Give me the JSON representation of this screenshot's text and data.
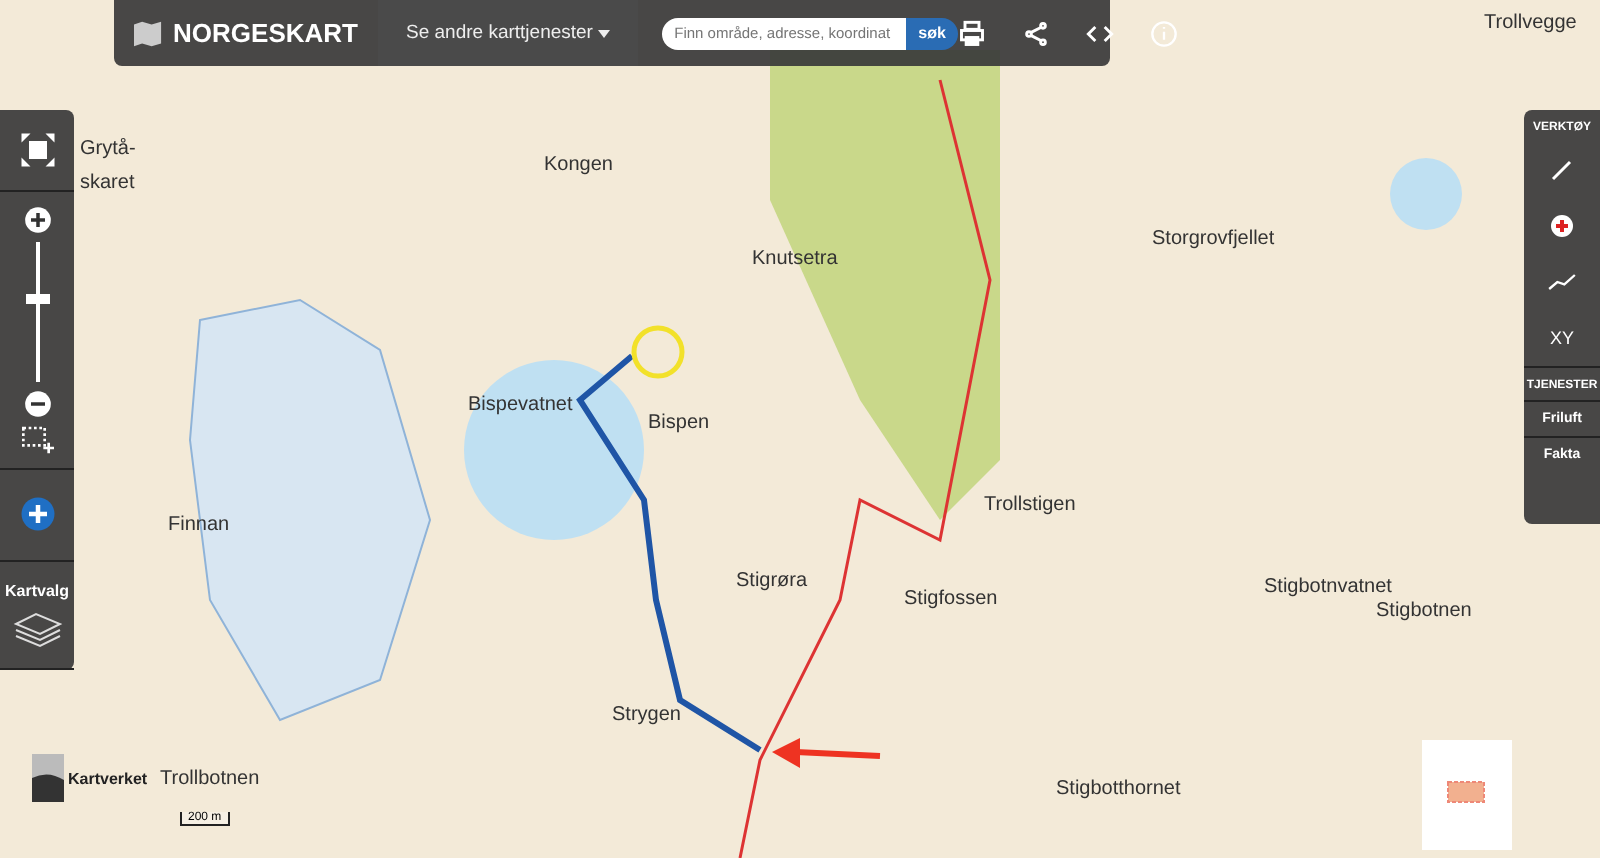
{
  "topbar": {
    "brand": "NORGESKART",
    "services_menu": "Se andre karttjenester",
    "search": {
      "placeholder": "Finn område, adresse, koordinat",
      "button": "søk"
    }
  },
  "left_panel": {
    "zoom": {
      "level": 0.6
    },
    "layers_label": "Kartvalg"
  },
  "right_panel": {
    "tools_title": "VERKTØY",
    "coordinate_tool": "XY",
    "services_title": "TJENESTER",
    "services": [
      "Friluft",
      "Fakta"
    ]
  },
  "map": {
    "labels": [
      "Trollvegge",
      "Kongen",
      "Grytå-",
      "skaret",
      "Knutsetra",
      "Storgrovfjellet",
      "Bispen",
      "Bispevatnet",
      "Trollstigen",
      "Finnan",
      "Stigrøra",
      "Stigfossen",
      "Stigbotnvatnet",
      "Stigbotnen",
      "Strygen",
      "Trollbotnen",
      "Stigbotthornet"
    ]
  },
  "attribution": {
    "logo_text": "Kartverket",
    "scale": "200 m"
  }
}
